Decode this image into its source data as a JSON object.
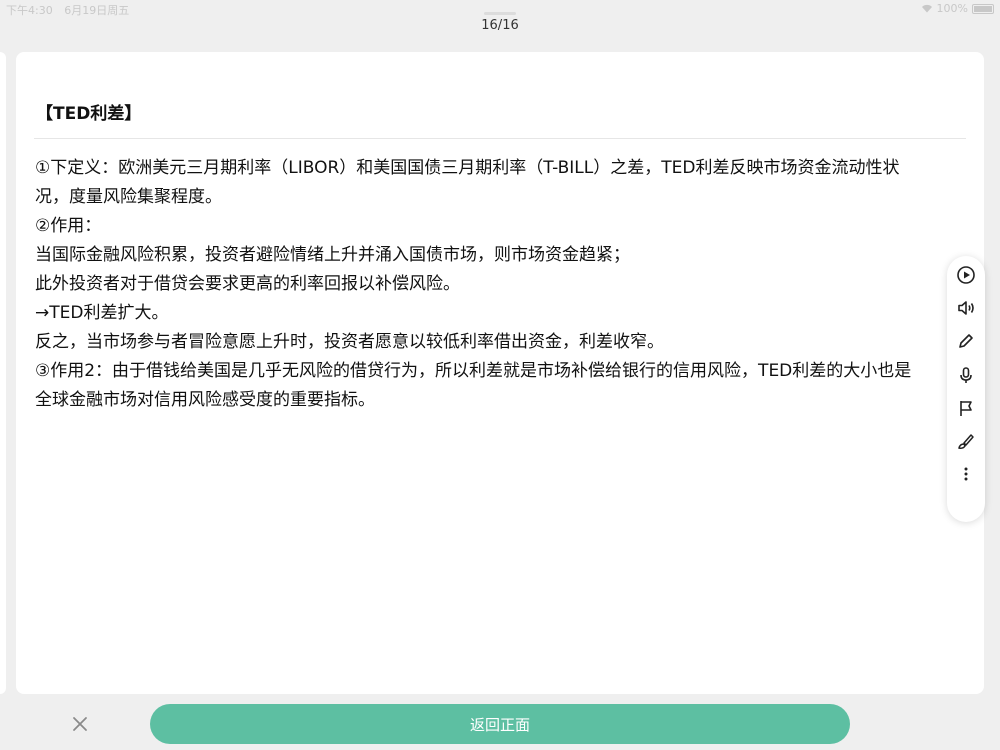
{
  "status_bar": {
    "time": "下午4:30",
    "date": "6月19日周五",
    "battery": "100%"
  },
  "pager": "16/16",
  "card": {
    "title": "【TED利差】",
    "lines": [
      "①下定义：欧洲美元三月期利率（LIBOR）和美国国债三月期利率（T-BILL）之差，TED利差反映市场资金流动性状",
      "况，度量风险集聚程度。",
      "②作用：",
      "当国际金融风险积累，投资者避险情绪上升并涌入国债市场，则市场资金趋紧；",
      "此外投资者对于借贷会要求更高的利率回报以补偿风险。",
      "→TED利差扩大。",
      "反之，当市场参与者冒险意愿上升时，投资者愿意以较低利率借出资金，利差收窄。",
      "③作用2：由于借钱给美国是几乎无风险的借贷行为，所以利差就是市场补偿给银行的信用风险，TED利差的大小也是",
      "全球金融市场对信用风险感受度的重要指标。"
    ]
  },
  "toolbar": {
    "icons": [
      "play-icon",
      "speaker-icon",
      "pencil-icon",
      "microphone-icon",
      "flag-icon",
      "brush-icon",
      "more-icon"
    ]
  },
  "bottom_bar": {
    "back_label": "返回正面"
  },
  "colors": {
    "accent": "#5dbfa2",
    "background": "#efefef"
  }
}
